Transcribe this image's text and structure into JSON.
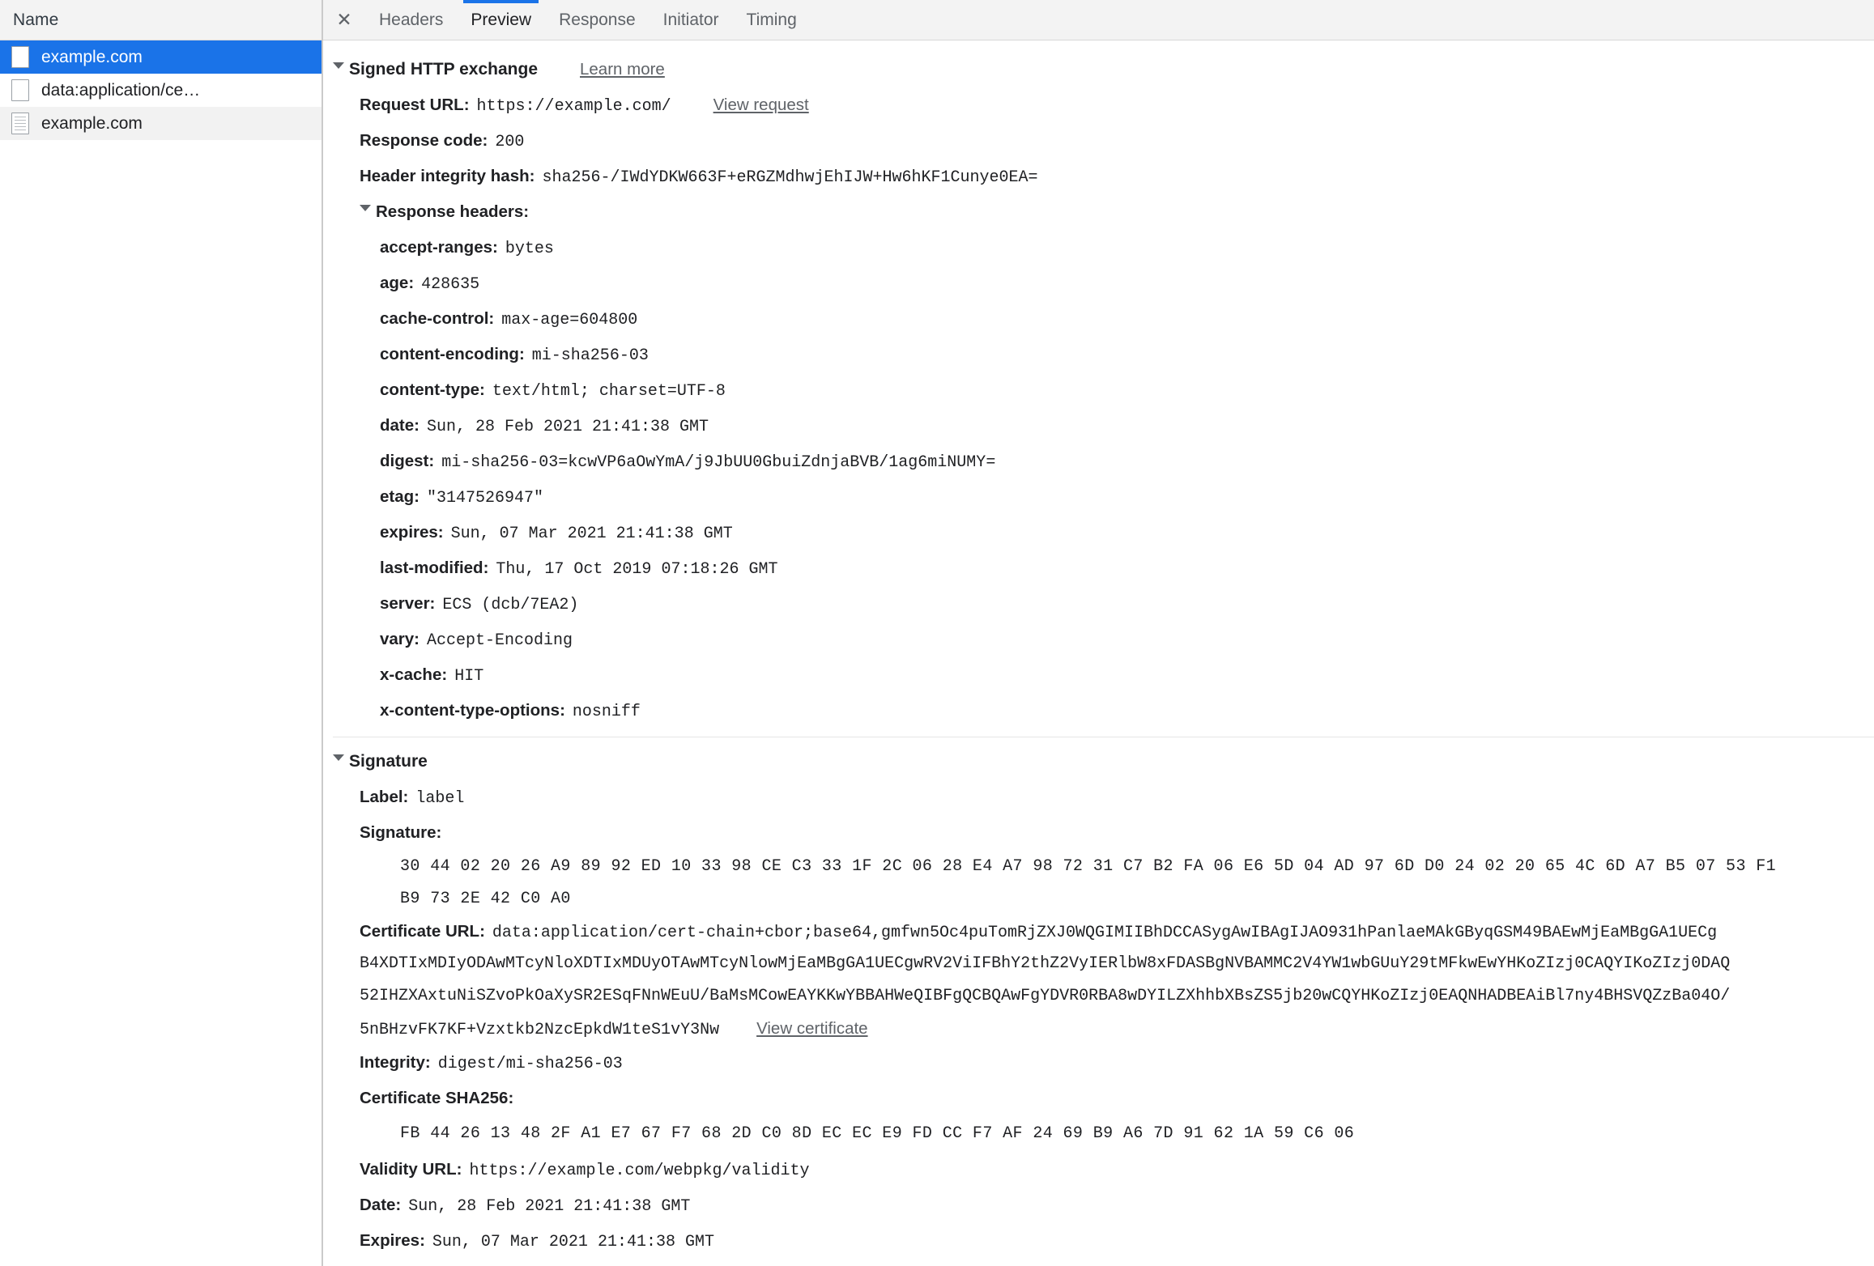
{
  "left_panel": {
    "column_header": "Name",
    "rows": [
      {
        "label": "example.com",
        "icon": "blank-page-icon",
        "selected": true
      },
      {
        "label": "data:application/ce…",
        "icon": "blank-page-icon",
        "selected": false
      },
      {
        "label": "example.com",
        "icon": "document-page-icon",
        "selected": false
      }
    ]
  },
  "tabbar": {
    "close_label": "✕",
    "tabs": [
      {
        "label": "Headers",
        "active": false
      },
      {
        "label": "Preview",
        "active": true
      },
      {
        "label": "Response",
        "active": false
      },
      {
        "label": "Initiator",
        "active": false
      },
      {
        "label": "Timing",
        "active": false
      }
    ]
  },
  "preview": {
    "sxg_section": {
      "title": "Signed HTTP exchange",
      "learn_more": "Learn more",
      "request_url_key": "Request URL:",
      "request_url_value": "https://example.com/",
      "view_request": "View request",
      "response_code_key": "Response code:",
      "response_code_value": "200",
      "header_integrity_key": "Header integrity hash:",
      "header_integrity_value": "sha256-/IWdYDKW663F+eRGZMdhwjEhIJW+Hw6hKF1Cunye0EA=",
      "response_headers_title": "Response headers:",
      "response_headers": [
        {
          "name": "accept-ranges:",
          "value": "bytes"
        },
        {
          "name": "age:",
          "value": "428635"
        },
        {
          "name": "cache-control:",
          "value": "max-age=604800"
        },
        {
          "name": "content-encoding:",
          "value": "mi-sha256-03"
        },
        {
          "name": "content-type:",
          "value": "text/html; charset=UTF-8"
        },
        {
          "name": "date:",
          "value": "Sun, 28 Feb 2021 21:41:38 GMT"
        },
        {
          "name": "digest:",
          "value": "mi-sha256-03=kcwVP6aOwYmA/j9JbUU0GbuiZdnjaBVB/1ag6miNUMY="
        },
        {
          "name": "etag:",
          "value": "\"3147526947\""
        },
        {
          "name": "expires:",
          "value": "Sun, 07 Mar 2021 21:41:38 GMT"
        },
        {
          "name": "last-modified:",
          "value": "Thu, 17 Oct 2019 07:18:26 GMT"
        },
        {
          "name": "server:",
          "value": "ECS (dcb/7EA2)"
        },
        {
          "name": "vary:",
          "value": "Accept-Encoding"
        },
        {
          "name": "x-cache:",
          "value": "HIT"
        },
        {
          "name": "x-content-type-options:",
          "value": "nosniff"
        }
      ]
    },
    "signature_section": {
      "title": "Signature",
      "label_key": "Label:",
      "label_value": "label",
      "signature_key": "Signature:",
      "signature_bytes_line1": "30 44 02 20 26 A9 89 92 ED 10 33 98 CE C3 33 1F 2C 06 28 E4 A7 98 72 31 C7 B2 FA 06 E6 5D 04 AD 97 6D D0 24 02 20 65 4C 6D A7 B5 07 53 F1",
      "signature_bytes_line2": "B9 73 2E 42 C0 A0",
      "certificate_url_key": "Certificate URL:",
      "certificate_url_lines": [
        "data:application/cert-chain+cbor;base64,gmfwn5Oc4puTomRjZXJ0WQGIMIIBhDCCASygAwIBAgIJAO931hPanlaeMAkGByqGSM49BAEwMjEaMBgGA1UECg",
        "B4XDTIxMDIyODAwMTcyNloXDTIxMDUyOTAwMTcyNlowMjEaMBgGA1UECgwRV2ViIFBhY2thZ2VyIERlbW8xFDASBgNVBAMMC2V4YW1wbGUuY29tMFkwEwYHKoZIzj0CAQYIKoZIzj0DAQ",
        "52IHZXAxtuNiSZvoPkOaXySR2ESqFNnWEuU/BaMsMCowEAYKKwYBBAHWeQIBFgQCBQAwFgYDVR0RBA8wDYILZXhhbXBsZS5jb20wCQYHKoZIzj0EAQNHADBEAiBl7ny4BHSVQZzBa04O/",
        "5nBHzvFK7KF+Vzxtkb2NzcEpkdW1teS1vY3Nw"
      ],
      "view_certificate": "View certificate",
      "integrity_key": "Integrity:",
      "integrity_value": "digest/mi-sha256-03",
      "certificate_sha256_key": "Certificate SHA256:",
      "certificate_sha256_value": "FB 44 26 13 48 2F A1 E7 67 F7 68 2D C0 8D EC EC E9 FD CC F7 AF 24 69 B9 A6 7D 91 62 1A 59 C6 06",
      "validity_url_key": "Validity URL:",
      "validity_url_value": "https://example.com/webpkg/validity",
      "date_key": "Date:",
      "date_value": "Sun, 28 Feb 2021 21:41:38 GMT",
      "expires_key": "Expires:",
      "expires_value": "Sun, 07 Mar 2021 21:41:38 GMT"
    }
  },
  "colors": {
    "selection_blue": "#1a73e8",
    "panel_gray": "#f3f3f3",
    "text_primary": "#202124",
    "text_secondary": "#5f6368"
  }
}
